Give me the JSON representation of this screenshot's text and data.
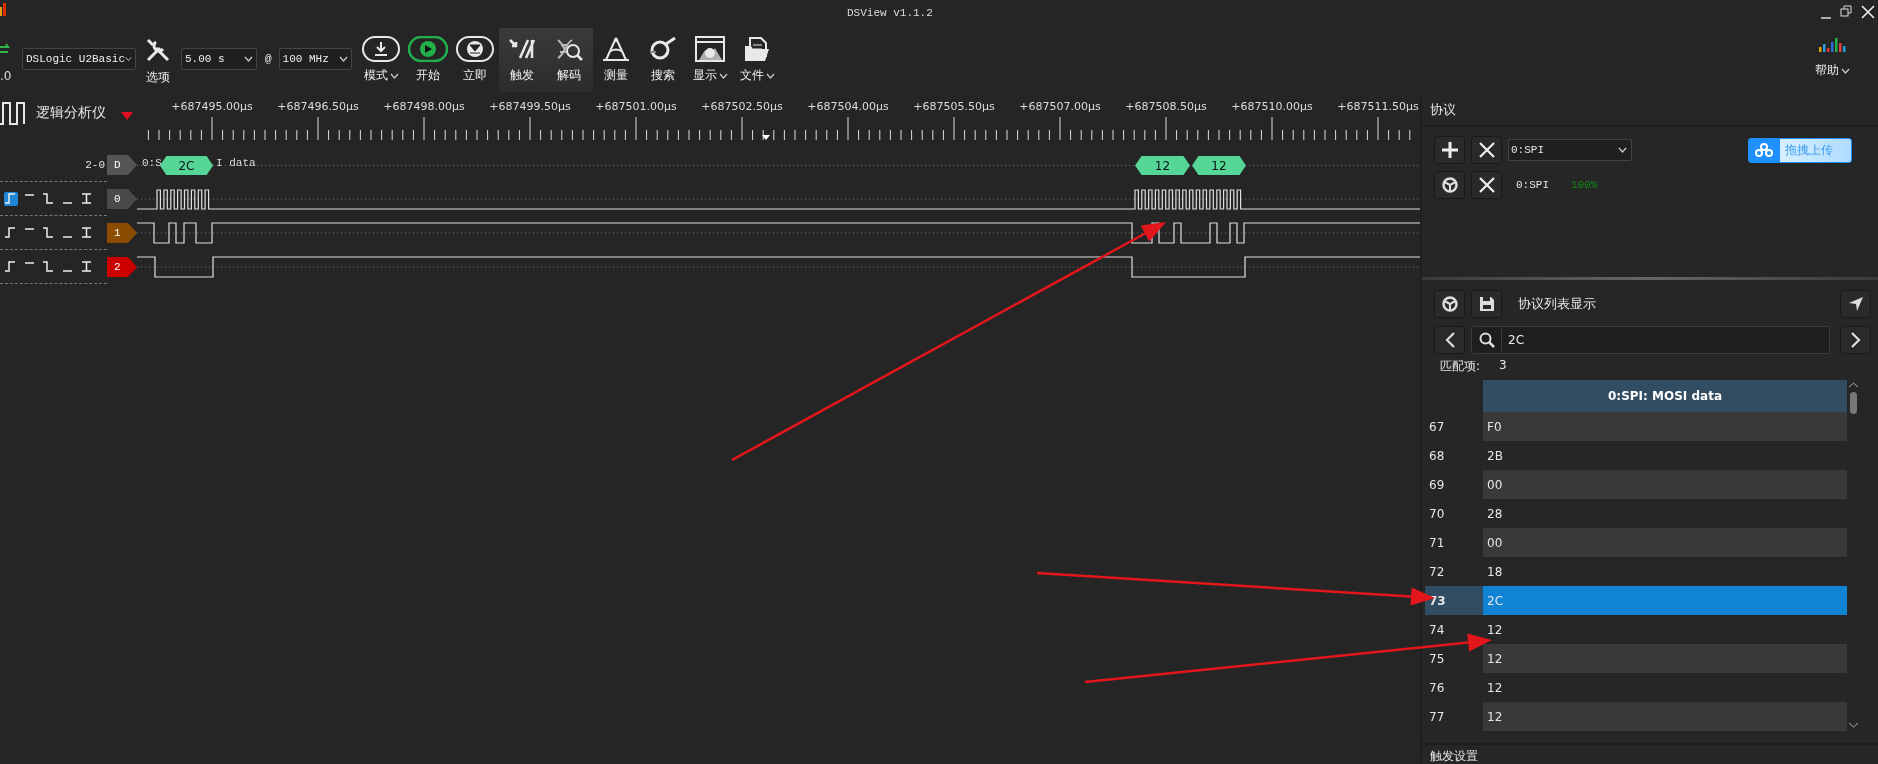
{
  "window": {
    "title": "DSView v1.1.2"
  },
  "toolbar": {
    "version_fragment": ".0",
    "device": "DSLogic U2Basic",
    "options_label": "选项",
    "duration": "5.00 s",
    "at": "@",
    "rate": "100 MHz",
    "buttons": [
      {
        "kind": "mode",
        "label": "模式",
        "menu": true,
        "active": false
      },
      {
        "kind": "start",
        "label": "开始",
        "menu": false,
        "active": false
      },
      {
        "kind": "instant",
        "label": "立即",
        "menu": false,
        "active": false
      },
      {
        "kind": "trigger",
        "label": "触发",
        "menu": false,
        "active": true
      },
      {
        "kind": "decode",
        "label": "解码",
        "menu": false,
        "active": true
      },
      {
        "kind": "measure",
        "label": "测量",
        "menu": false,
        "active": false
      },
      {
        "kind": "search",
        "label": "搜索",
        "menu": false,
        "active": false
      },
      {
        "kind": "display",
        "label": "显示",
        "menu": true,
        "active": false
      },
      {
        "kind": "file",
        "label": "文件",
        "menu": true,
        "active": false
      }
    ],
    "help": {
      "label": "帮助",
      "menu": true
    }
  },
  "ruler": {
    "mode_label": "逻辑分析仪",
    "labels": [
      "+687495.00μs",
      "+687496.50μs",
      "+687498.00μs",
      "+687499.50μs",
      "+687501.00μs",
      "+687502.50μs",
      "+687504.00μs",
      "+687505.50μs",
      "+687507.00μs",
      "+687508.50μs",
      "+687510.00μs",
      "+687511.50μs"
    ]
  },
  "decoder_row": {
    "range": "2-0",
    "label": "D",
    "title_start": "0:S",
    "title_end": "I data",
    "annotations": [
      "2C",
      "12",
      "12"
    ]
  },
  "channels": [
    {
      "label": "0",
      "color": "#4a4a4a",
      "triggers": [
        {
          "kind": "rising",
          "selected": true
        },
        {
          "kind": "high",
          "selected": false
        },
        {
          "kind": "falling",
          "selected": false
        },
        {
          "kind": "low",
          "selected": false
        },
        {
          "kind": "edge",
          "selected": false
        }
      ]
    },
    {
      "label": "1",
      "color": "#8b4c00",
      "triggers": [
        {
          "kind": "rising",
          "selected": false
        },
        {
          "kind": "high",
          "selected": false
        },
        {
          "kind": "falling",
          "selected": false
        },
        {
          "kind": "low",
          "selected": false
        },
        {
          "kind": "edge",
          "selected": false
        }
      ]
    },
    {
      "label": "2",
      "color": "#cc0000",
      "triggers": [
        {
          "kind": "rising",
          "selected": false
        },
        {
          "kind": "high",
          "selected": false
        },
        {
          "kind": "falling",
          "selected": false
        },
        {
          "kind": "low",
          "selected": false
        },
        {
          "kind": "edge",
          "selected": false
        }
      ]
    }
  ],
  "protocol_panel": {
    "title": "协议",
    "decoder_select": "0:SPI",
    "upload_label": "拖拽上传",
    "decoders": [
      {
        "name": "0:SPI",
        "progress": "100%",
        "complete": true
      }
    ]
  },
  "list_panel": {
    "title": "协议列表显示",
    "search": "2C",
    "match_label": "匹配项:",
    "match_count": "3",
    "table": {
      "columns": [
        "0:SPI: MOSI data"
      ],
      "rows": [
        {
          "index": "67",
          "value": "F0",
          "selected": false
        },
        {
          "index": "68",
          "value": "2B",
          "selected": false
        },
        {
          "index": "69",
          "value": "00",
          "selected": false
        },
        {
          "index": "70",
          "value": "28",
          "selected": false
        },
        {
          "index": "71",
          "value": "00",
          "selected": false
        },
        {
          "index": "72",
          "value": "18",
          "selected": false
        },
        {
          "index": "73",
          "value": "2C",
          "selected": true
        },
        {
          "index": "74",
          "value": "12",
          "selected": false
        },
        {
          "index": "75",
          "value": "12",
          "selected": false
        },
        {
          "index": "76",
          "value": "12",
          "selected": false
        },
        {
          "index": "77",
          "value": "12",
          "selected": false
        }
      ]
    }
  },
  "trigger_panel": {
    "title": "触发设置"
  }
}
